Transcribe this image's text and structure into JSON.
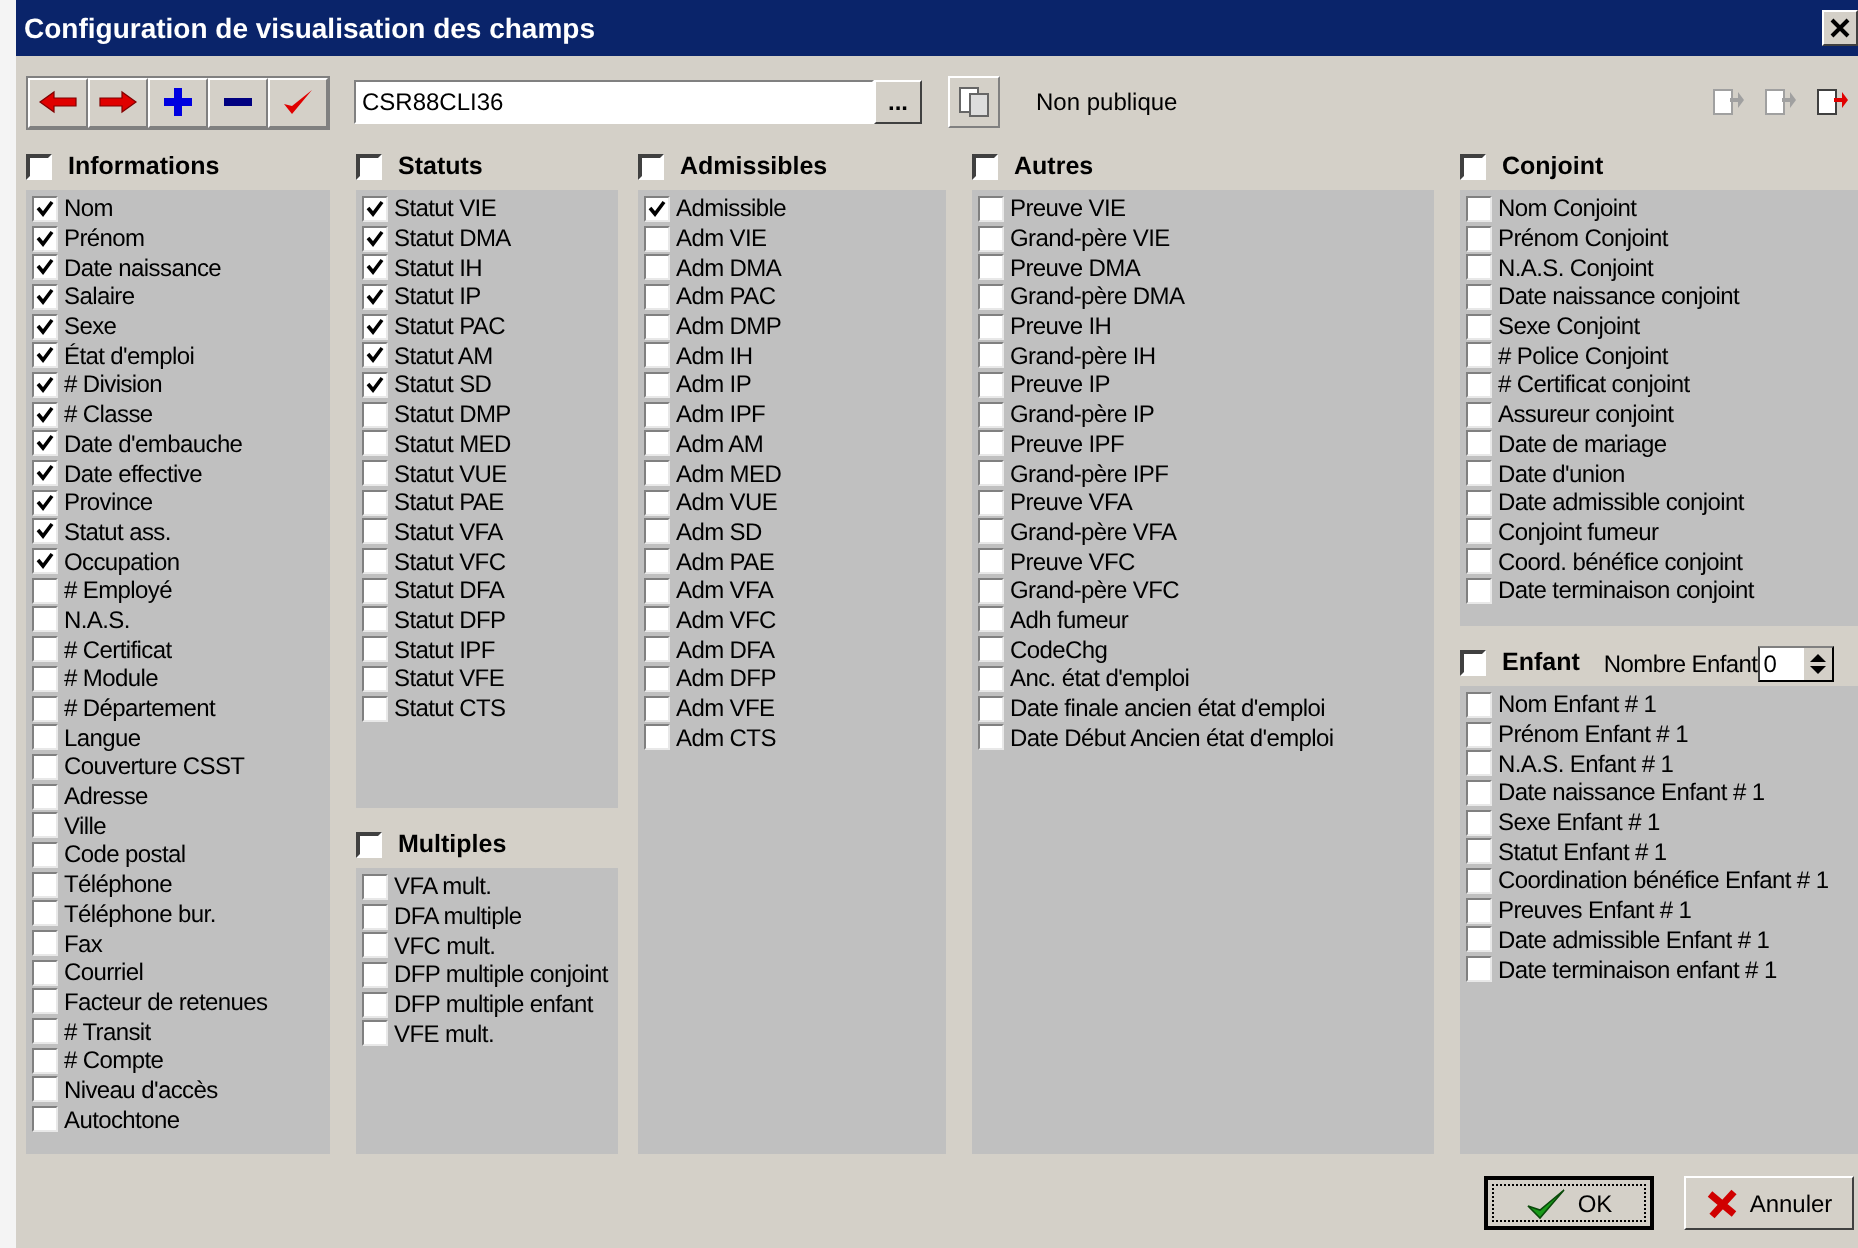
{
  "window": {
    "title": "Configuration de visualisation des champs"
  },
  "toolbar": {
    "field_value": "CSR88CLI36",
    "browse_label": "...",
    "visibility": "Non publique",
    "right_buttons": [
      {
        "disabled": true
      },
      {
        "disabled": true
      },
      {
        "disabled": false
      }
    ]
  },
  "columns": [
    {
      "groups": [
        {
          "title": "Informations",
          "checked": false,
          "items": [
            {
              "label": "Nom",
              "checked": true
            },
            {
              "label": "Prénom",
              "checked": true
            },
            {
              "label": "Date naissance",
              "checked": true
            },
            {
              "label": "Salaire",
              "checked": true
            },
            {
              "label": "Sexe",
              "checked": true
            },
            {
              "label": "État d'emploi",
              "checked": true
            },
            {
              "label": "# Division",
              "checked": true
            },
            {
              "label": "# Classe",
              "checked": true
            },
            {
              "label": "Date d'embauche",
              "checked": true
            },
            {
              "label": "Date effective",
              "checked": true
            },
            {
              "label": "Province",
              "checked": true
            },
            {
              "label": "Statut ass.",
              "checked": true
            },
            {
              "label": "Occupation",
              "checked": true
            },
            {
              "label": "# Employé",
              "checked": false
            },
            {
              "label": "N.A.S.",
              "checked": false
            },
            {
              "label": "# Certificat",
              "checked": false
            },
            {
              "label": "# Module",
              "checked": false
            },
            {
              "label": "# Département",
              "checked": false
            },
            {
              "label": "Langue",
              "checked": false
            },
            {
              "label": "Couverture CSST",
              "checked": false
            },
            {
              "label": "Adresse",
              "checked": false
            },
            {
              "label": "Ville",
              "checked": false
            },
            {
              "label": "Code postal",
              "checked": false
            },
            {
              "label": "Téléphone",
              "checked": false
            },
            {
              "label": "Téléphone bur.",
              "checked": false
            },
            {
              "label": "Fax",
              "checked": false
            },
            {
              "label": "Courriel",
              "checked": false
            },
            {
              "label": "Facteur de retenues",
              "checked": false
            },
            {
              "label": "# Transit",
              "checked": false
            },
            {
              "label": "# Compte",
              "checked": false
            },
            {
              "label": "Niveau d'accès",
              "checked": false
            },
            {
              "label": "Autochtone",
              "checked": false
            }
          ]
        }
      ]
    },
    {
      "groups": [
        {
          "title": "Statuts",
          "checked": false,
          "items": [
            {
              "label": "Statut VIE",
              "checked": true
            },
            {
              "label": "Statut DMA",
              "checked": true
            },
            {
              "label": "Statut IH",
              "checked": true
            },
            {
              "label": "Statut IP",
              "checked": true
            },
            {
              "label": "Statut PAC",
              "checked": true
            },
            {
              "label": "Statut AM",
              "checked": true
            },
            {
              "label": "Statut SD",
              "checked": true
            },
            {
              "label": "Statut DMP",
              "checked": false
            },
            {
              "label": "Statut MED",
              "checked": false
            },
            {
              "label": "Statut VUE",
              "checked": false
            },
            {
              "label": "Statut PAE",
              "checked": false
            },
            {
              "label": "Statut VFA",
              "checked": false
            },
            {
              "label": "Statut VFC",
              "checked": false
            },
            {
              "label": "Statut DFA",
              "checked": false
            },
            {
              "label": "Statut DFP",
              "checked": false
            },
            {
              "label": "Statut IPF",
              "checked": false
            },
            {
              "label": "Statut VFE",
              "checked": false
            },
            {
              "label": "Statut CTS",
              "checked": false
            }
          ]
        },
        {
          "title": "Multiples",
          "checked": false,
          "items": [
            {
              "label": "VFA mult.",
              "checked": false
            },
            {
              "label": "DFA multiple",
              "checked": false
            },
            {
              "label": "VFC mult.",
              "checked": false
            },
            {
              "label": "DFP multiple conjoint",
              "checked": false
            },
            {
              "label": "DFP multiple enfant",
              "checked": false
            },
            {
              "label": "VFE mult.",
              "checked": false
            }
          ]
        }
      ]
    },
    {
      "groups": [
        {
          "title": "Admissibles",
          "checked": false,
          "items": [
            {
              "label": "Admissible",
              "checked": true
            },
            {
              "label": "Adm VIE",
              "checked": false
            },
            {
              "label": "Adm DMA",
              "checked": false
            },
            {
              "label": "Adm PAC",
              "checked": false
            },
            {
              "label": "Adm DMP",
              "checked": false
            },
            {
              "label": "Adm IH",
              "checked": false
            },
            {
              "label": "Adm IP",
              "checked": false
            },
            {
              "label": "Adm IPF",
              "checked": false
            },
            {
              "label": "Adm AM",
              "checked": false
            },
            {
              "label": "Adm MED",
              "checked": false
            },
            {
              "label": "Adm VUE",
              "checked": false
            },
            {
              "label": "Adm SD",
              "checked": false
            },
            {
              "label": "Adm PAE",
              "checked": false
            },
            {
              "label": "Adm VFA",
              "checked": false
            },
            {
              "label": "Adm VFC",
              "checked": false
            },
            {
              "label": "Adm DFA",
              "checked": false
            },
            {
              "label": "Adm DFP",
              "checked": false
            },
            {
              "label": "Adm VFE",
              "checked": false
            },
            {
              "label": "Adm CTS",
              "checked": false
            }
          ]
        }
      ]
    },
    {
      "groups": [
        {
          "title": "Autres",
          "checked": false,
          "items": [
            {
              "label": "Preuve VIE",
              "checked": false
            },
            {
              "label": "Grand-père VIE",
              "checked": false
            },
            {
              "label": "Preuve DMA",
              "checked": false
            },
            {
              "label": "Grand-père DMA",
              "checked": false
            },
            {
              "label": "Preuve IH",
              "checked": false
            },
            {
              "label": "Grand-père IH",
              "checked": false
            },
            {
              "label": "Preuve IP",
              "checked": false
            },
            {
              "label": "Grand-père IP",
              "checked": false
            },
            {
              "label": "Preuve IPF",
              "checked": false
            },
            {
              "label": "Grand-père IPF",
              "checked": false
            },
            {
              "label": "Preuve VFA",
              "checked": false
            },
            {
              "label": "Grand-père VFA",
              "checked": false
            },
            {
              "label": "Preuve VFC",
              "checked": false
            },
            {
              "label": "Grand-père VFC",
              "checked": false
            },
            {
              "label": "Adh fumeur",
              "checked": false
            },
            {
              "label": "CodeChg",
              "checked": false
            },
            {
              "label": "Anc. état d'emploi",
              "checked": false
            },
            {
              "label": "Date finale ancien état d'emploi",
              "checked": false
            },
            {
              "label": "Date Début Ancien état d'emploi",
              "checked": false
            }
          ]
        }
      ]
    },
    {
      "groups": [
        {
          "title": "Conjoint",
          "checked": false,
          "items": [
            {
              "label": "Nom Conjoint",
              "checked": false
            },
            {
              "label": "Prénom Conjoint",
              "checked": false
            },
            {
              "label": "N.A.S. Conjoint",
              "checked": false
            },
            {
              "label": "Date naissance conjoint",
              "checked": false
            },
            {
              "label": "Sexe Conjoint",
              "checked": false
            },
            {
              "label": "# Police Conjoint",
              "checked": false
            },
            {
              "label": "# Certificat conjoint",
              "checked": false
            },
            {
              "label": "Assureur conjoint",
              "checked": false
            },
            {
              "label": "Date de mariage",
              "checked": false
            },
            {
              "label": "Date d'union",
              "checked": false
            },
            {
              "label": "Date admissible conjoint",
              "checked": false
            },
            {
              "label": "Conjoint fumeur",
              "checked": false
            },
            {
              "label": "Coord. bénéfice conjoint",
              "checked": false
            },
            {
              "label": "Date terminaison conjoint",
              "checked": false
            }
          ]
        },
        {
          "title": "Enfant",
          "checked": false,
          "count_label": "Nombre Enfant",
          "count_value": "0",
          "items": [
            {
              "label": "Nom Enfant # 1",
              "checked": false
            },
            {
              "label": "Prénom Enfant # 1",
              "checked": false
            },
            {
              "label": "N.A.S. Enfant # 1",
              "checked": false
            },
            {
              "label": "Date naissance Enfant # 1",
              "checked": false
            },
            {
              "label": "Sexe Enfant # 1",
              "checked": false
            },
            {
              "label": "Statut Enfant # 1",
              "checked": false
            },
            {
              "label": "Coordination bénéfice Enfant # 1",
              "checked": false
            },
            {
              "label": "Preuves Enfant # 1",
              "checked": false
            },
            {
              "label": "Date admissible Enfant # 1",
              "checked": false
            },
            {
              "label": "Date terminaison enfant # 1",
              "checked": false
            }
          ]
        }
      ]
    }
  ],
  "buttons": [
    {
      "kind": "ok",
      "label": "OK"
    },
    {
      "kind": "cancel",
      "label": "Annuler"
    }
  ]
}
